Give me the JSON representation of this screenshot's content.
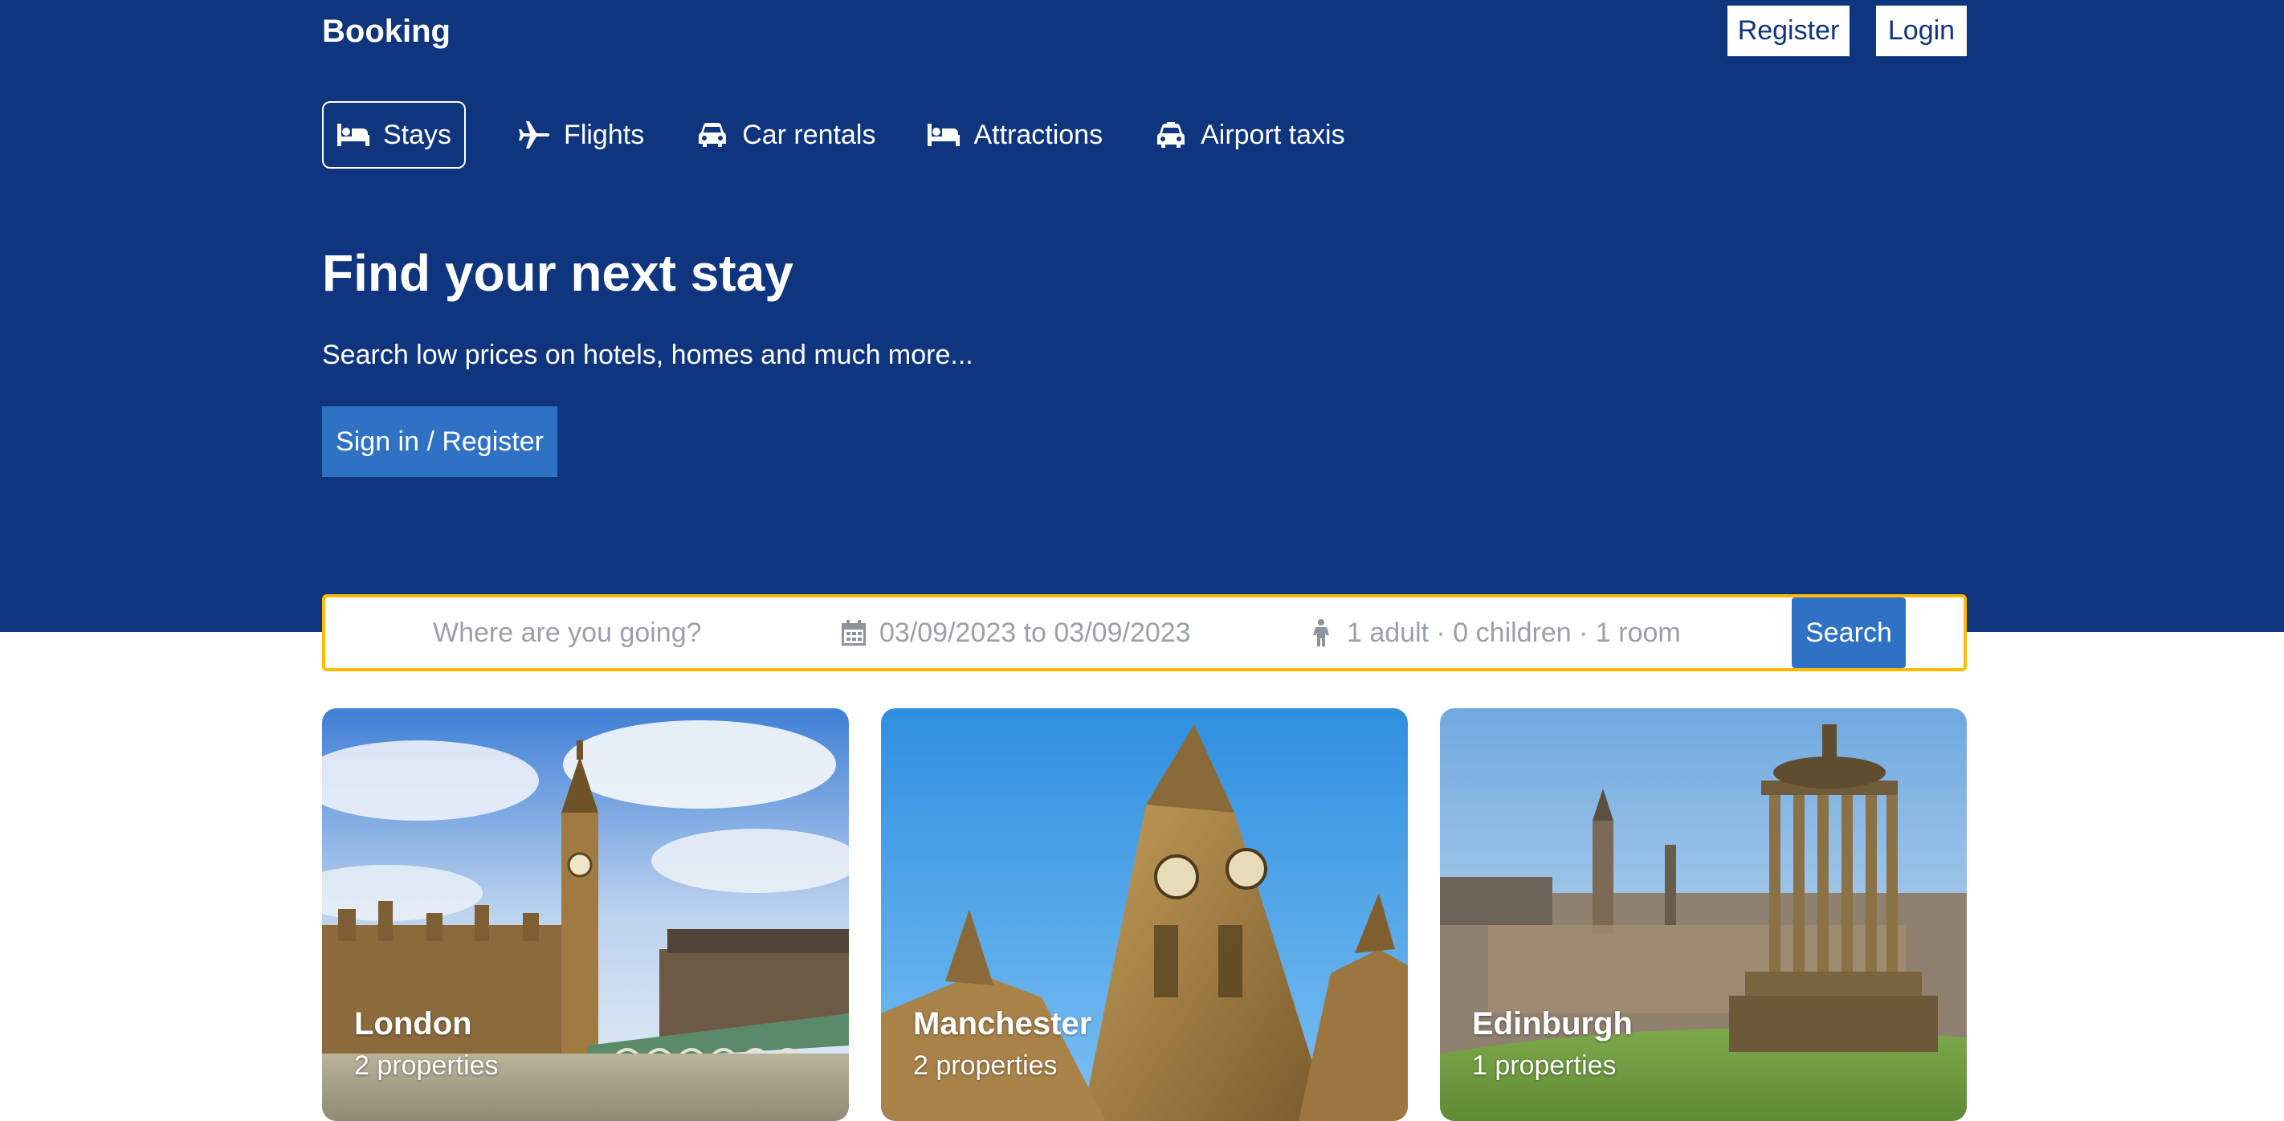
{
  "header": {
    "brand": "Booking",
    "register_label": "Register",
    "login_label": "Login"
  },
  "nav": {
    "items": [
      {
        "label": "Stays",
        "icon": "bed-icon",
        "active": true
      },
      {
        "label": "Flights",
        "icon": "plane-icon"
      },
      {
        "label": "Car rentals",
        "icon": "car-icon"
      },
      {
        "label": "Attractions",
        "icon": "bed-icon"
      },
      {
        "label": "Airport taxis",
        "icon": "taxi-icon"
      }
    ]
  },
  "hero": {
    "title": "Find your next stay",
    "subtitle": "Search low prices on hotels, homes and much more...",
    "signin_label": "Sign in / Register"
  },
  "search": {
    "destination_placeholder": "Where are you going?",
    "dates": "03/09/2023 to 03/09/2023",
    "guests": "1 adult · 0 children · 1 room",
    "button_label": "Search"
  },
  "destinations": [
    {
      "name": "London",
      "count": "2 properties"
    },
    {
      "name": "Manchester",
      "count": "2 properties"
    },
    {
      "name": "Edinburgh",
      "count": "1 properties"
    }
  ],
  "colors": {
    "brand_blue": "#0f357e",
    "button_blue": "#2f71c4",
    "search_border": "#febb02"
  }
}
